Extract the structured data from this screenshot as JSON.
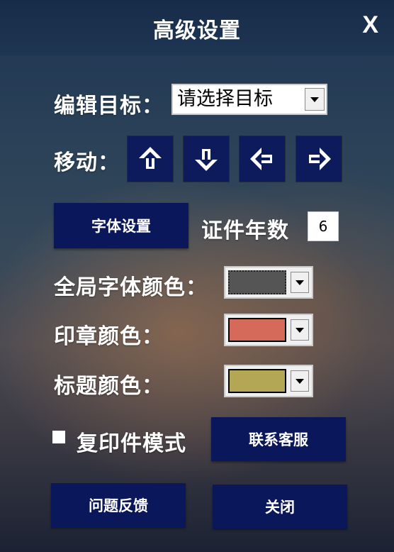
{
  "window": {
    "title": "高级设置",
    "close_label": "X"
  },
  "edit_target": {
    "label": "编辑目标：",
    "selected": "请选择目标"
  },
  "move": {
    "label": "移动：",
    "buttons": [
      "up-arrow-icon",
      "down-arrow-icon",
      "left-arrow-icon",
      "right-arrow-icon"
    ]
  },
  "font_settings_button": "字体设置",
  "cert_years": {
    "label": "证件年数",
    "value": "6"
  },
  "global_font_color": {
    "label": "全局字体颜色：",
    "color": "#555555"
  },
  "seal_color": {
    "label": "印章颜色：",
    "color": "#d66a5a"
  },
  "title_color": {
    "label": "标题颜色：",
    "color": "#b3a655"
  },
  "copy_mode": {
    "label": "复印件模式",
    "checked": false
  },
  "buttons": {
    "contact_support": "联系客服",
    "feedback": "问题反馈",
    "close": "关闭"
  }
}
